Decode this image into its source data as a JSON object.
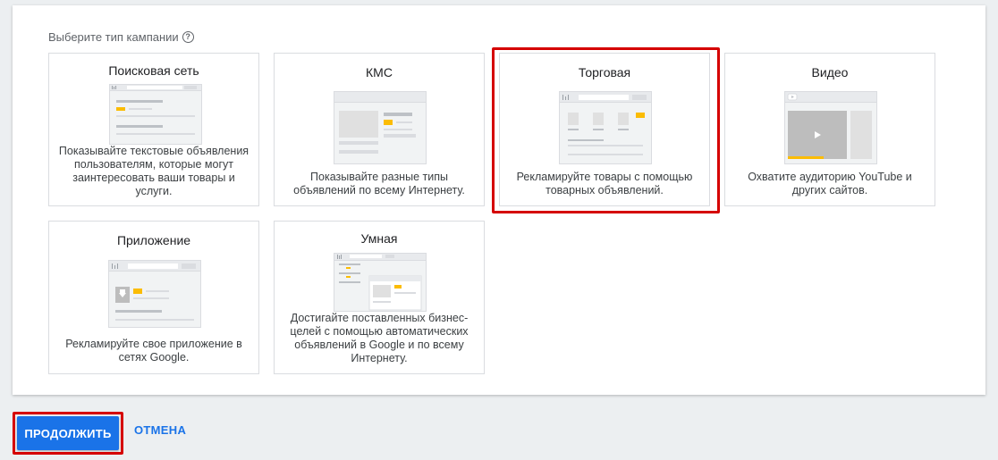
{
  "prompt": {
    "label": "Выберите тип кампании",
    "help_icon": "help-circle-icon"
  },
  "campaign_types": [
    {
      "title": "Поисковая сеть",
      "description": "Показывайте текстовые объявления пользователям, которые могут заинтересовать ваши товары и услуги.",
      "icon": "search-network-illustration"
    },
    {
      "title": "КМС",
      "description": "Показывайте разные типы объявлений по всему Интернету.",
      "icon": "display-network-illustration"
    },
    {
      "title": "Торговая",
      "description": "Рекламируйте товары с помощью товарных объявлений.",
      "icon": "shopping-illustration",
      "highlighted": true
    },
    {
      "title": "Видео",
      "description": "Охватите аудиторию YouTube и других сайтов.",
      "icon": "video-illustration"
    },
    {
      "title": "Приложение",
      "description": "Рекламируйте свое приложение в сетях Google.",
      "icon": "app-illustration"
    },
    {
      "title": "Умная",
      "description": "Достигайте поставленных бизнес-целей с помощью автоматических объявлений в Google и по всему Интернету.",
      "icon": "smart-illustration"
    }
  ],
  "actions": {
    "continue_label": "ПРОДОЛЖИТЬ",
    "cancel_label": "ОТМЕНА"
  },
  "colors": {
    "accent": "#1a73e8",
    "highlight": "#d50000",
    "illustration_yellow": "#fbbc04"
  }
}
